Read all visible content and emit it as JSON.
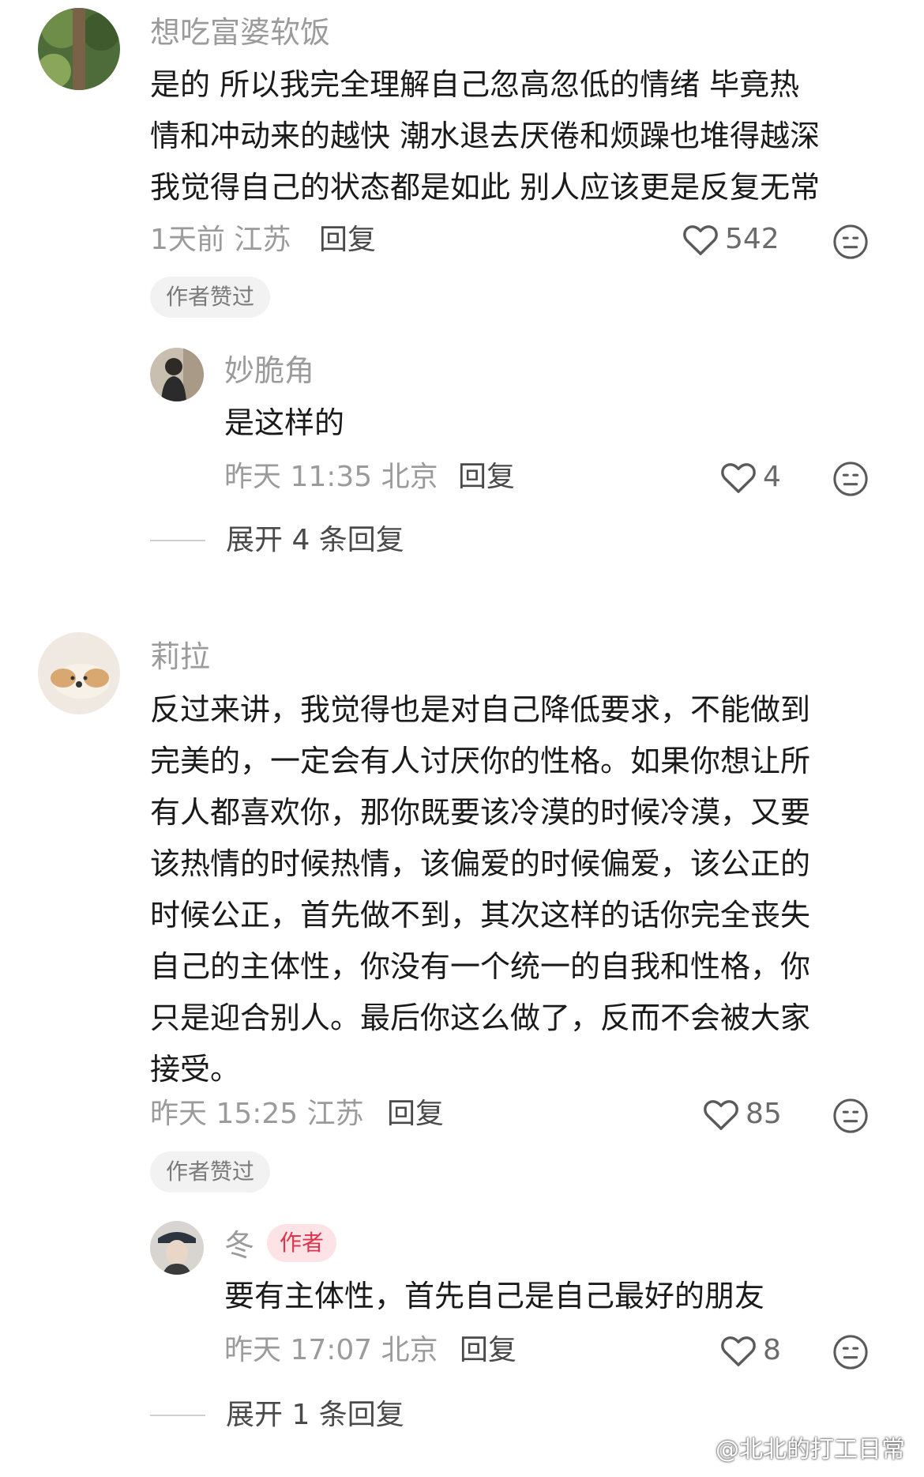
{
  "comments": [
    {
      "username": "想吃富婆软饭",
      "lines": [
        "是的 所以我完全理解自己忽高忽低的情绪 毕竟热",
        "情和冲动来的越快 潮水退去厌倦和烦躁也堆得越深",
        "我觉得自己的状态都是如此 别人应该更是反复无常"
      ],
      "time": "1天前 江苏",
      "reply": "回复",
      "likes": "542",
      "badge": "作者赞过",
      "replies": [
        {
          "username": "妙脆角",
          "text": "是这样的",
          "time": "昨天 11:35 北京",
          "reply": "回复",
          "likes": "4"
        }
      ],
      "expand": "展开 4 条回复"
    },
    {
      "username": "莉拉",
      "lines": [
        "反过来讲，我觉得也是对自己降低要求，不能做到",
        "完美的，一定会有人讨厌你的性格。如果你想让所",
        "有人都喜欢你，那你既要该冷漠的时候冷漠，又要",
        "该热情的时候热情，该偏爱的时候偏爱，该公正的",
        "时候公正，首先做不到，其次这样的话你完全丧失",
        "自己的主体性，你没有一个统一的自我和性格，你",
        "只是迎合别人。最后你这么做了，反而不会被大家",
        "接受。"
      ],
      "time": "昨天 15:25 江苏",
      "reply": "回复",
      "likes": "85",
      "badge": "作者赞过",
      "replies": [
        {
          "username": "冬",
          "author_tag": "作者",
          "text": "要有主体性，首先自己是自己最好的朋友",
          "time": "昨天 17:07 北京",
          "reply": "回复",
          "likes": "8"
        }
      ],
      "expand": "展开 1 条回复"
    }
  ],
  "watermark": "@北北的打工日常",
  "colors": {
    "meta": "#9b9b9b",
    "author_tag_bg": "#fde3e6",
    "author_tag_fg": "#e0334c",
    "badge_bg": "#f2f2f2"
  }
}
